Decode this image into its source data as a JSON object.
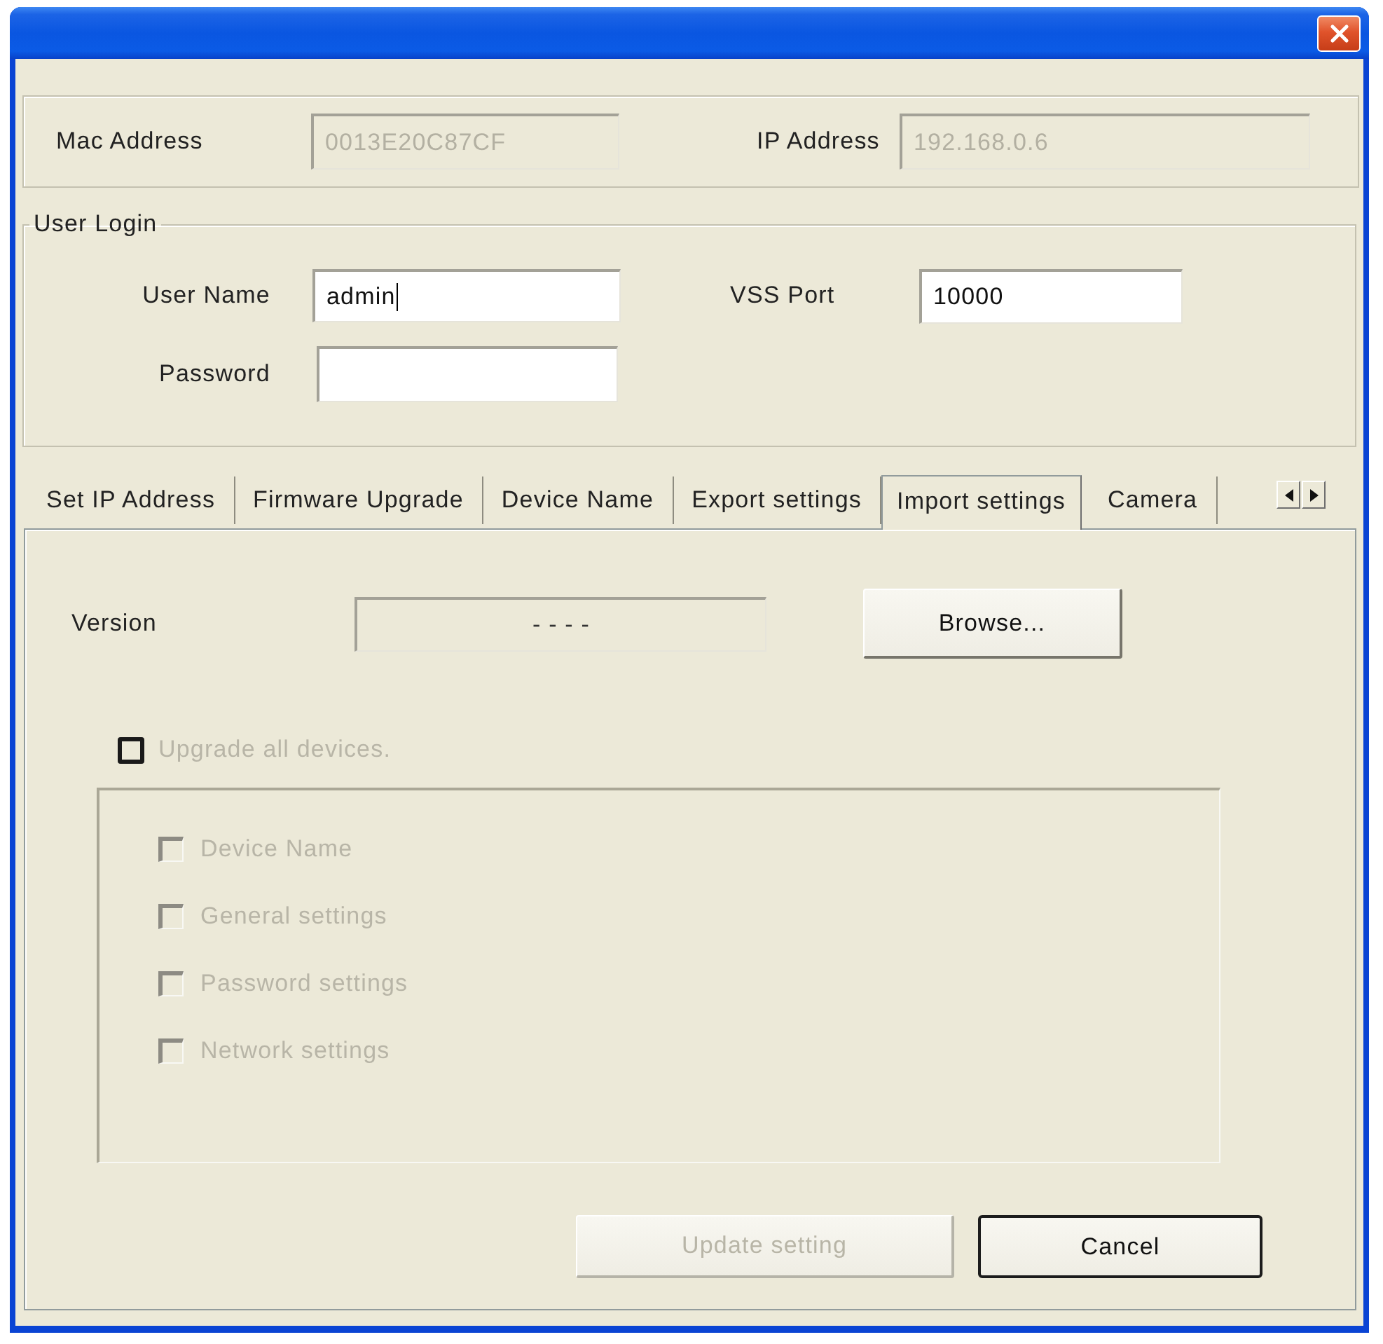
{
  "device": [
    {
      "label": "Mac Address",
      "value": "0013E20C87CF",
      "disabled": true
    },
    {
      "label": "IP Address",
      "value": "192.168.0.6",
      "disabled": true
    }
  ],
  "user_login": {
    "title": "User Login",
    "fields": [
      {
        "label": "User Name",
        "value": "admin",
        "focused": true,
        "disabled": false
      },
      {
        "label": "Password",
        "focused": false,
        "disabled": false
      },
      {
        "label": "VSS Port",
        "value": "10000",
        "focused": false,
        "disabled": false
      }
    ]
  },
  "tabs": [
    {
      "label": "Set IP Address",
      "selected": false
    },
    {
      "label": "Firmware Upgrade",
      "selected": false
    },
    {
      "label": "Device Name",
      "selected": false
    },
    {
      "label": "Export settings",
      "selected": false
    },
    {
      "label": "Import settings",
      "selected": true
    },
    {
      "label": "Camera",
      "selected": false
    }
  ],
  "import_settings": {
    "version": {
      "label": "Version",
      "value": "- - - -"
    },
    "browse_button": "Browse...",
    "upgrade_all": {
      "label": "Upgrade all devices.",
      "checked": false,
      "disabled": true
    },
    "options": [
      {
        "label": "Device Name",
        "checked": false,
        "disabled": true
      },
      {
        "label": "General settings",
        "checked": false,
        "disabled": true
      },
      {
        "label": "Password settings",
        "checked": false,
        "disabled": true
      },
      {
        "label": "Network settings",
        "checked": false,
        "disabled": true
      }
    ]
  },
  "buttons": [
    {
      "label": "Update setting",
      "disabled": true,
      "default": false
    },
    {
      "label": "Cancel",
      "disabled": false,
      "default": true
    }
  ]
}
